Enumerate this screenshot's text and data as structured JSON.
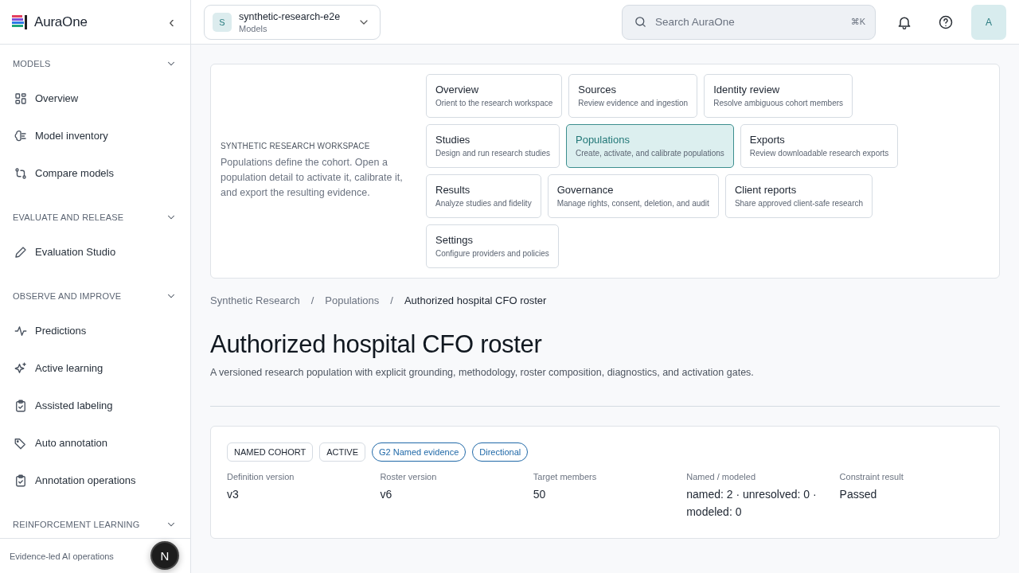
{
  "sidebar": {
    "brand": "AuraOne",
    "collapse": "‹",
    "sections": [
      {
        "title": "MODELS",
        "expanded": true,
        "items": [
          {
            "label": "Overview"
          },
          {
            "label": "Model inventory"
          },
          {
            "label": "Compare models"
          }
        ]
      },
      {
        "title": "EVALUATE AND RELEASE",
        "expanded": true,
        "items": [
          {
            "label": "Evaluation Studio"
          }
        ]
      },
      {
        "title": "OBSERVE AND IMPROVE",
        "expanded": true,
        "items": [
          {
            "label": "Predictions"
          },
          {
            "label": "Active learning"
          },
          {
            "label": "Assisted labeling"
          },
          {
            "label": "Auto annotation"
          },
          {
            "label": "Annotation operations"
          }
        ]
      },
      {
        "title": "REINFORCEMENT LEARNING",
        "expanded": true
      }
    ],
    "footer": "Evidence-led AI operations",
    "dev_badge": "N"
  },
  "header": {
    "workspace": {
      "initial": "S",
      "name": "synthetic-research-e2e",
      "subtitle": "Models"
    },
    "search": {
      "placeholder": "Search AuraOne",
      "shortcut": "⌘K"
    },
    "avatar": "A"
  },
  "workspace_panel": {
    "eyebrow": "SYNTHETIC RESEARCH WORKSPACE",
    "description": "Populations define the cohort. Open a population detail to activate it, calibrate it, and export the resulting evidence.",
    "nav_rows": [
      [
        {
          "title": "Overview",
          "subtitle": "Orient to the research workspace",
          "selected": false
        },
        {
          "title": "Sources",
          "subtitle": "Review evidence and ingestion",
          "selected": false
        },
        {
          "title": "Identity review",
          "subtitle": "Resolve ambiguous cohort members",
          "selected": false
        }
      ],
      [
        {
          "title": "Studies",
          "subtitle": "Design and run research studies",
          "selected": false
        },
        {
          "title": "Populations",
          "subtitle": "Create, activate, and calibrate populations",
          "selected": true
        },
        {
          "title": "Exports",
          "subtitle": "Review downloadable research exports",
          "selected": false
        }
      ],
      [
        {
          "title": "Results",
          "subtitle": "Analyze studies and fidelity",
          "selected": false
        },
        {
          "title": "Governance",
          "subtitle": "Manage rights, consent, deletion, and audit",
          "selected": false
        },
        {
          "title": "Client reports",
          "subtitle": "Share approved client-safe research",
          "selected": false
        }
      ],
      [
        {
          "title": "Settings",
          "subtitle": "Configure providers and policies",
          "selected": false
        }
      ]
    ]
  },
  "breadcrumb": [
    {
      "kind": "link",
      "label": "Synthetic Research"
    },
    {
      "kind": "separator",
      "label": "/"
    },
    {
      "kind": "link",
      "label": "Populations"
    },
    {
      "kind": "separator",
      "label": "/"
    },
    {
      "kind": "current",
      "label": "Authorized hospital CFO roster"
    }
  ],
  "page": {
    "title": "Authorized hospital CFO roster",
    "description": "A versioned research population with explicit grounding, methodology, roster composition, diagnostics, and activation gates."
  },
  "summary": {
    "tags": [
      {
        "label": "NAMED COHORT",
        "kind": "neutral"
      },
      {
        "label": "ACTIVE",
        "kind": "neutral"
      },
      {
        "label": "G2 Named evidence",
        "kind": "info"
      },
      {
        "label": "Directional",
        "kind": "info"
      }
    ],
    "stats": [
      {
        "label": "Definition version",
        "value": "v3"
      },
      {
        "label": "Roster version",
        "value": "v6"
      },
      {
        "label": "Target members",
        "value": "50"
      },
      {
        "label": "Named / modeled",
        "value": "named: 2 · unresolved: 0 · modeled: 0"
      },
      {
        "label": "Constraint result",
        "value": "Passed"
      }
    ]
  }
}
